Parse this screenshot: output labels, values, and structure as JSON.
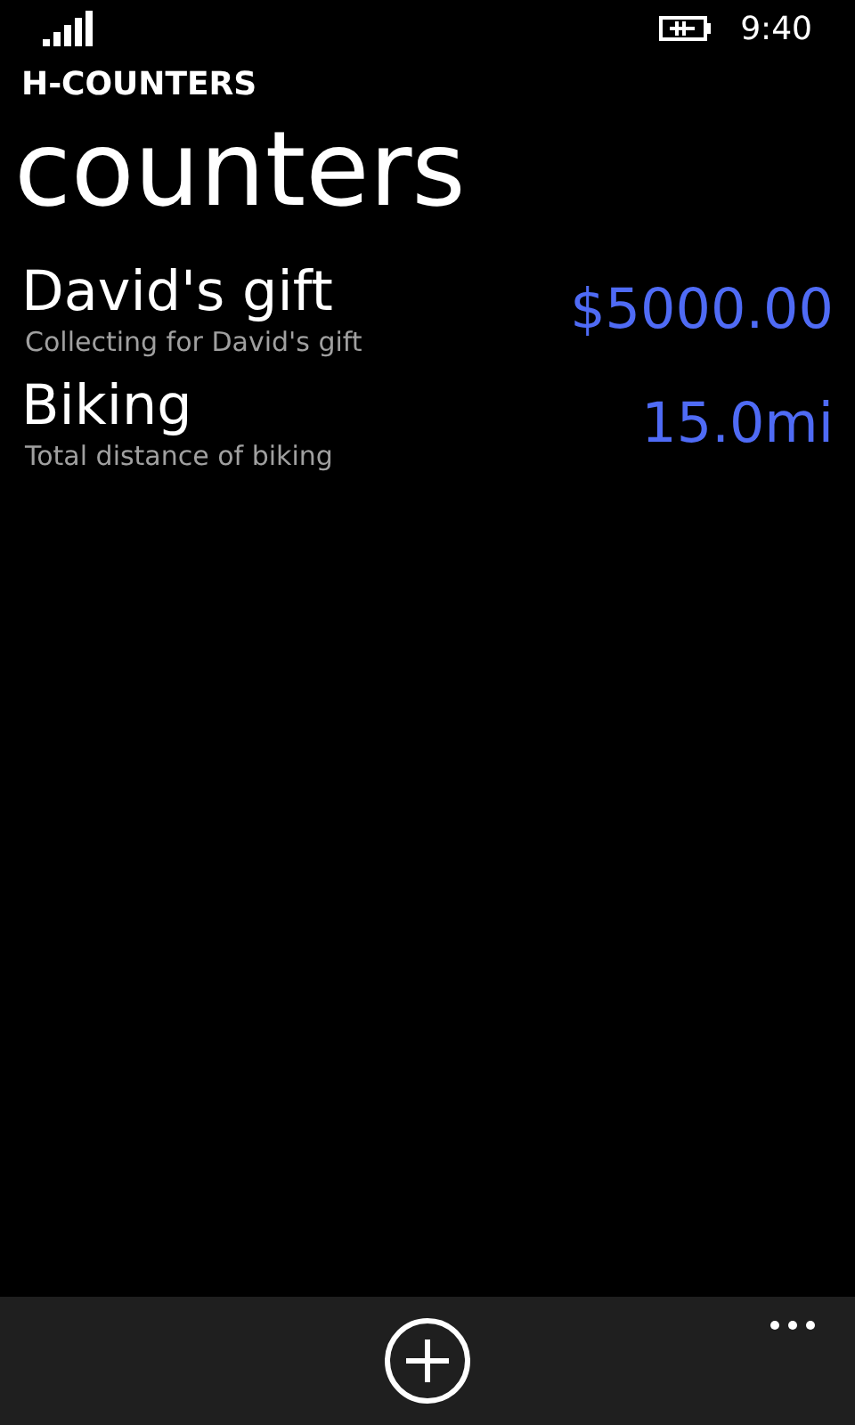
{
  "status_bar": {
    "time": "9:40"
  },
  "app_title": "H-COUNTERS",
  "page_title": "counters",
  "counters": [
    {
      "name": "David's gift",
      "description": "Collecting for David's gift",
      "value": "$5000.00"
    },
    {
      "name": "Biking",
      "description": "Total distance of biking",
      "value": "15.0mi"
    }
  ]
}
